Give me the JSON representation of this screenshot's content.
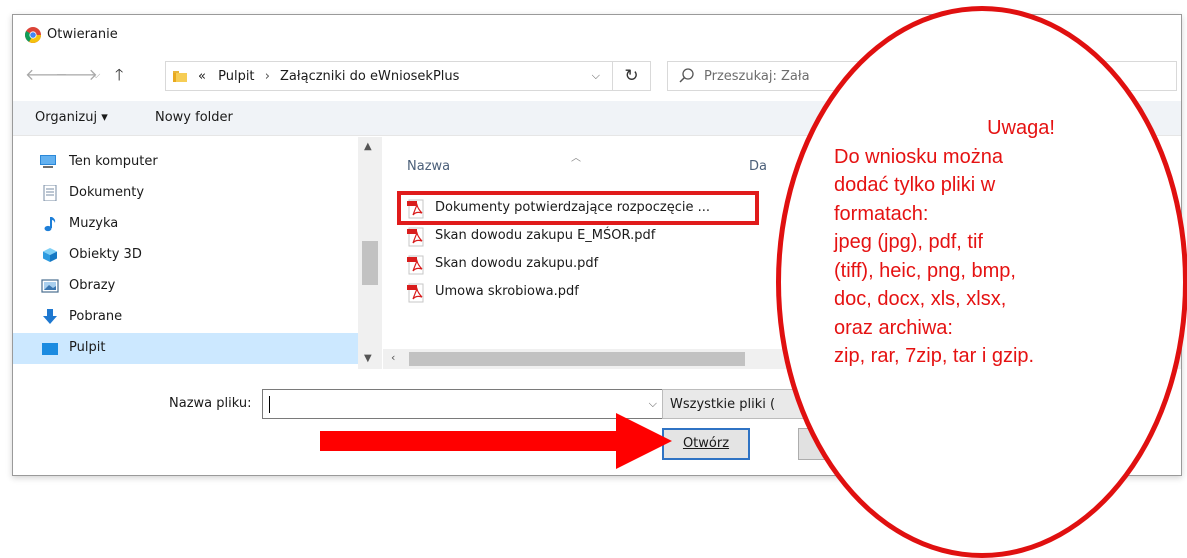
{
  "dialog": {
    "title": "Otwieranie"
  },
  "nav": {
    "back_icon": "arrow-left-icon",
    "forward_icon": "arrow-right-icon",
    "recent_icon": "chevron-down-icon",
    "up_icon": "arrow-up-icon",
    "breadcrumb": {
      "prefix": "«",
      "items": [
        "Pulpit",
        "Załączniki do eWniosekPlus"
      ],
      "separator": "›"
    },
    "refresh_icon": "refresh-icon",
    "search_placeholder": "Przeszukaj: Zała"
  },
  "toolbar": {
    "organize_label": "Organizuj ▾",
    "new_folder_label": "Nowy folder"
  },
  "nav_pane": {
    "items": [
      {
        "label": "Ten komputer",
        "icon": "computer-icon"
      },
      {
        "label": "Dokumenty",
        "icon": "documents-icon"
      },
      {
        "label": "Muzyka",
        "icon": "music-icon"
      },
      {
        "label": "Obiekty 3D",
        "icon": "3d-objects-icon"
      },
      {
        "label": "Obrazy",
        "icon": "pictures-icon"
      },
      {
        "label": "Pobrane",
        "icon": "downloads-icon"
      },
      {
        "label": "Pulpit",
        "icon": "desktop-icon"
      }
    ],
    "selected": "Pulpit"
  },
  "file_list": {
    "columns": {
      "name": "Nazwa",
      "date": "Da"
    },
    "files": [
      {
        "name": "Dokumenty potwierdzające rozpoczęcie ...",
        "icon": "pdf-icon"
      },
      {
        "name": "Skan dowodu zakupu E_MŚOR.pdf",
        "icon": "pdf-icon"
      },
      {
        "name": "Skan dowodu zakupu.pdf",
        "icon": "pdf-icon"
      },
      {
        "name": "Umowa skrobiowa.pdf",
        "icon": "pdf-icon"
      }
    ]
  },
  "footer": {
    "filename_label": "Nazwa pliku:",
    "filename_value": "",
    "filetype_label": "Wszystkie pliki (",
    "open_label": "Otwórz"
  },
  "annotation": {
    "title": "Uwaga!",
    "lines": [
      "Do wniosku można",
      "dodać tylko pliki w",
      "formatach:",
      "jpeg (jpg), pdf, tif",
      "(tiff), heic, png, bmp,",
      "doc, docx, xls, xlsx,",
      "oraz archiwa:",
      "zip, rar, 7zip, tar i gzip."
    ]
  },
  "colors": {
    "accent_red": "#e01010",
    "selection_blue": "#cce8ff",
    "button_focus_blue": "#2f73c4"
  }
}
